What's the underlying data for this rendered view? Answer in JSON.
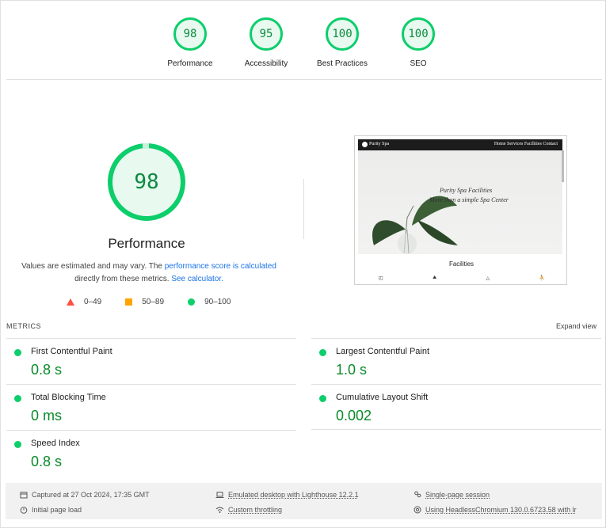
{
  "top_gauges": [
    {
      "score": "98",
      "label": "Performance"
    },
    {
      "score": "95",
      "label": "Accessibility"
    },
    {
      "score": "100",
      "label": "Best Practices"
    },
    {
      "score": "100",
      "label": "SEO"
    }
  ],
  "summary": {
    "score": "98",
    "title": "Performance",
    "note_text_1": "Values are estimated and may vary. The ",
    "note_link_1": "performance score is calculated",
    "note_text_2": "directly from these metrics. ",
    "note_link_2": "See calculator."
  },
  "legend": [
    {
      "range": "0–49",
      "shape": "triangle",
      "color": "#ff4e42"
    },
    {
      "range": "50–89",
      "shape": "square",
      "color": "#ffa400"
    },
    {
      "range": "90–100",
      "shape": "circle",
      "color": "#0cce6b"
    }
  ],
  "thumbnail": {
    "brand": "Purity Spa",
    "nav_links": "Home  Services  Facilities  Contact",
    "hero_line_1": "Purity Spa Facilities",
    "hero_line_2": "More than a simple Spa Center",
    "section_title": "Facilities"
  },
  "metrics": {
    "section_label": "METRICS",
    "expand_label": "Expand view",
    "left": [
      {
        "name": "First Contentful Paint",
        "value": "0.8 s"
      },
      {
        "name": "Total Blocking Time",
        "value": "0 ms"
      },
      {
        "name": "Speed Index",
        "value": "0.8 s"
      }
    ],
    "right": [
      {
        "name": "Largest Contentful Paint",
        "value": "1.0 s"
      },
      {
        "name": "Cumulative Layout Shift",
        "value": "0.002"
      }
    ]
  },
  "footer": {
    "captured": "Captured at 27 Oct 2024, 17:35 GMT",
    "initial_load": "Initial page load",
    "emulated": "Emulated desktop with Lighthouse 12.2.1",
    "throttling": "Custom throttling",
    "session": "Single-page session",
    "browser": "Using HeadlessChromium 130.0.6723.58 with lr"
  },
  "colors": {
    "pass": "#0cce6b",
    "pass_text": "#0a8a2b",
    "average": "#ffa400",
    "fail": "#ff4e42",
    "link": "#1a73e8"
  }
}
